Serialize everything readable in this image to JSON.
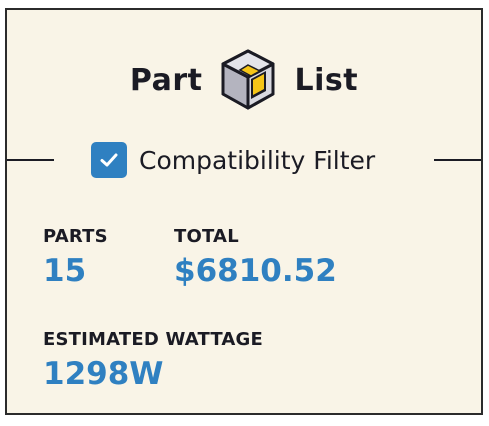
{
  "header": {
    "title_left": "Part",
    "title_right": "List",
    "icon": "cube-icon"
  },
  "filter": {
    "label": "Compatibility Filter",
    "checked": true,
    "icon": "checkmark-icon"
  },
  "stats": {
    "parts_label": "PARTS",
    "parts_value": "15",
    "total_label": "TOTAL",
    "total_value": "$6810.52",
    "wattage_label": "ESTIMATED WATTAGE",
    "wattage_value": "1298W"
  },
  "colors": {
    "accent": "#2f80c1",
    "checkbox": "#2f80c1",
    "panel_bg": "#f9f4e7",
    "text": "#1b1b24",
    "cube_yellow": "#f5c518"
  }
}
